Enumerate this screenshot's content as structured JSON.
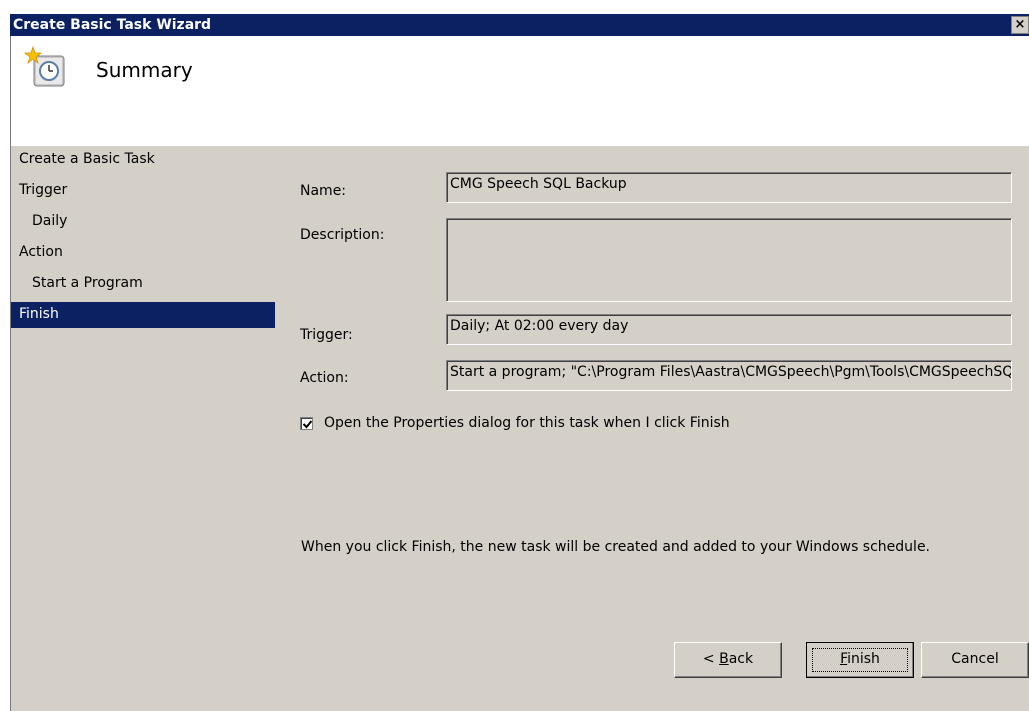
{
  "window": {
    "title": "Create Basic Task Wizard",
    "close_glyph": "×"
  },
  "header": {
    "icon": "task-scheduler-clock-icon",
    "title": "Summary"
  },
  "steps": [
    {
      "label": "Create a Basic Task",
      "active": false
    },
    {
      "label": "Trigger",
      "active": false
    },
    {
      "label": "Daily",
      "active": false
    },
    {
      "label": "Action",
      "active": false
    },
    {
      "label": "Start a Program",
      "active": false
    },
    {
      "label": "Finish",
      "active": true
    }
  ],
  "summary": {
    "name_label": "Name:",
    "name_value": "CMG Speech SQL Backup",
    "description_label": "Description:",
    "description_value": "",
    "trigger_label": "Trigger:",
    "trigger_value": "Daily; At 02:00 every day",
    "action_label": "Action:",
    "action_value": "Start a program; \"C:\\Program Files\\Aastra\\CMGSpeech\\Pgm\\Tools\\CMGSpeechSQLBackup.exe\""
  },
  "open_properties": {
    "checked": true,
    "label": "Open the Properties dialog for this task when I click Finish"
  },
  "info_text": "When you click Finish, the new task will be created and added to your Windows schedule.",
  "buttons": {
    "back_mnemonic": "B",
    "back_prefix": "< ",
    "back_rest": "ack",
    "finish_mnemonic": "F",
    "finish_rest": "inish",
    "cancel": "Cancel"
  }
}
